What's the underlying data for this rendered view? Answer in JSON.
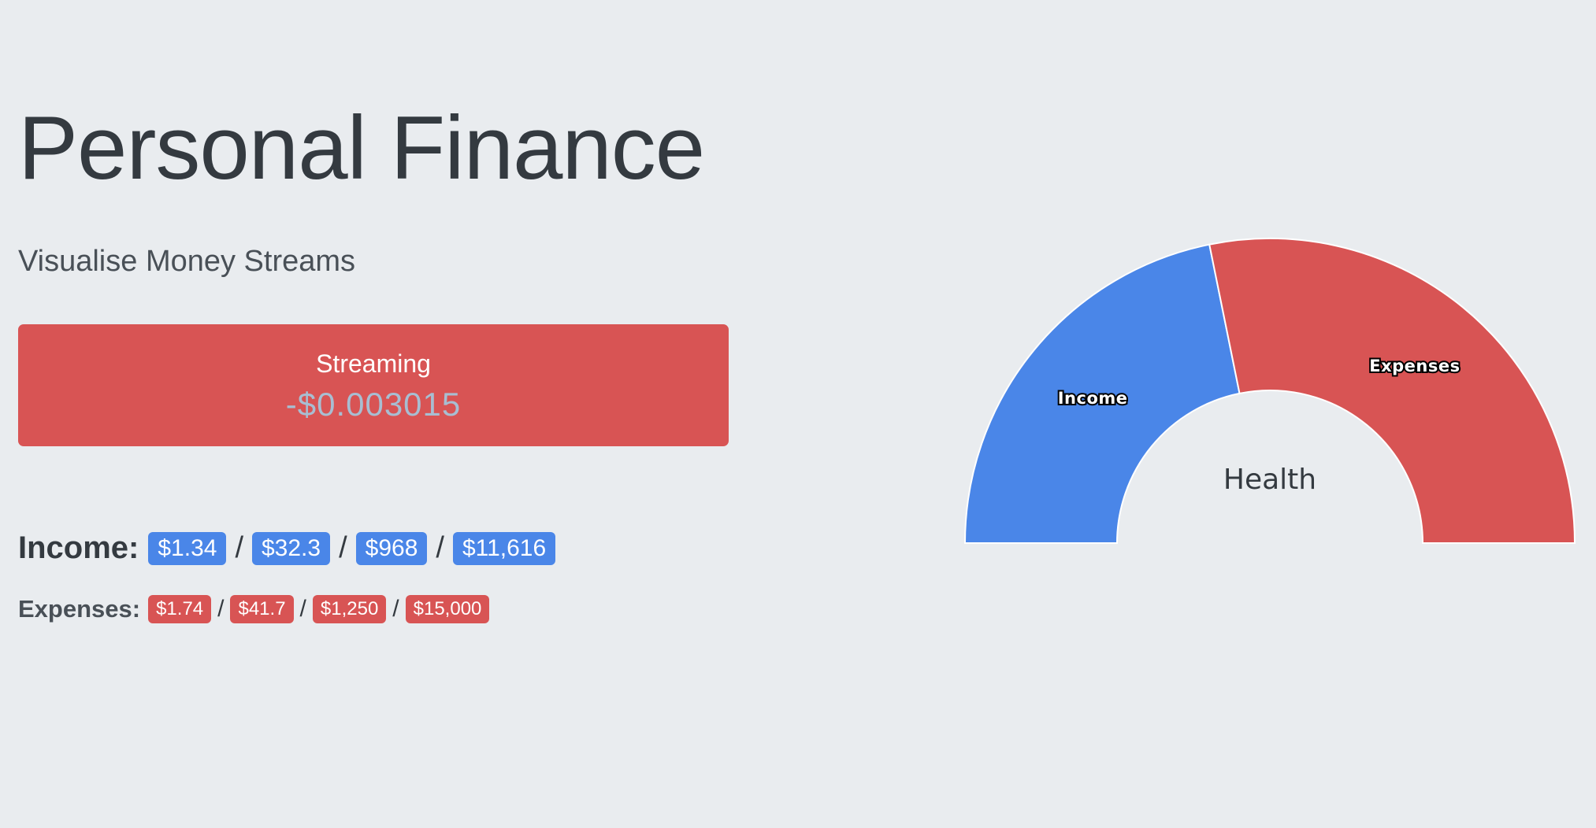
{
  "header": {
    "title": "Personal Finance",
    "subtitle": "Visualise Money Streams"
  },
  "streaming": {
    "label": "Streaming",
    "value": "-$0.003015"
  },
  "income": {
    "label": "Income:",
    "rates": [
      "$1.34",
      "$32.3",
      "$968",
      "$11,616"
    ],
    "separator": "/"
  },
  "expenses": {
    "label": "Expenses:",
    "rates": [
      "$1.74",
      "$41.7",
      "$1,250",
      "$15,000"
    ],
    "separator": "/"
  },
  "colors": {
    "income": "#4a86e8",
    "expenses": "#d85454",
    "background": "#e9ecef"
  },
  "chart_data": {
    "type": "pie",
    "subtype": "half-doughnut",
    "title": "",
    "center_label": "Health",
    "slices": [
      {
        "name": "Income",
        "value": 11616,
        "color": "#4a86e8"
      },
      {
        "name": "Expenses",
        "value": 15000,
        "color": "#d85454"
      }
    ],
    "legend": "none"
  }
}
